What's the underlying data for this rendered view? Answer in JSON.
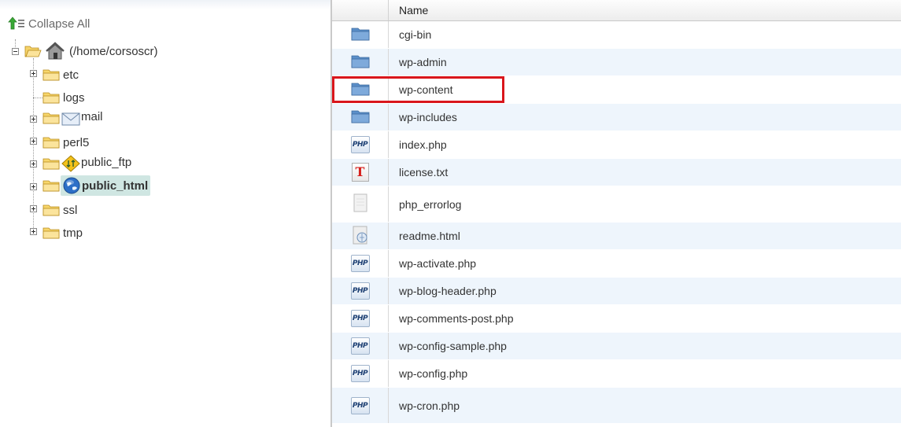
{
  "tree": {
    "collapse_all_label": "Collapse All",
    "root_label": "(/home/corsoscr)",
    "items": [
      {
        "label": "etc",
        "expandable": true,
        "icon": "folder-icon"
      },
      {
        "label": "logs",
        "expandable": false,
        "icon": "folder-icon"
      },
      {
        "label": "mail",
        "expandable": true,
        "icon": "mail-icon"
      },
      {
        "label": "perl5",
        "expandable": true,
        "icon": "folder-icon"
      },
      {
        "label": "public_ftp",
        "expandable": true,
        "icon": "ftp-icon"
      },
      {
        "label": "public_html",
        "expandable": true,
        "icon": "globe-icon",
        "selected": true
      },
      {
        "label": "ssl",
        "expandable": true,
        "icon": "folder-icon"
      },
      {
        "label": "tmp",
        "expandable": true,
        "icon": "folder-icon"
      }
    ]
  },
  "table": {
    "name_header": "Name",
    "rows": [
      {
        "name": "cgi-bin",
        "type": "folder"
      },
      {
        "name": "wp-admin",
        "type": "folder"
      },
      {
        "name": "wp-content",
        "type": "folder",
        "highlighted": true
      },
      {
        "name": "wp-includes",
        "type": "folder"
      },
      {
        "name": "index.php",
        "type": "php"
      },
      {
        "name": "license.txt",
        "type": "text"
      },
      {
        "name": "php_errorlog",
        "type": "generic"
      },
      {
        "name": "readme.html",
        "type": "html"
      },
      {
        "name": "wp-activate.php",
        "type": "php"
      },
      {
        "name": "wp-blog-header.php",
        "type": "php"
      },
      {
        "name": "wp-comments-post.php",
        "type": "php"
      },
      {
        "name": "wp-config-sample.php",
        "type": "php"
      },
      {
        "name": "wp-config.php",
        "type": "php"
      },
      {
        "name": "wp-cron.php",
        "type": "php"
      }
    ],
    "php_icon_text": "PHP",
    "text_icon_letter": "T"
  },
  "colors": {
    "highlight_border": "#d9161c",
    "selected_bg": "#cfe6e2",
    "alt_row_bg": "#eef5fc"
  }
}
